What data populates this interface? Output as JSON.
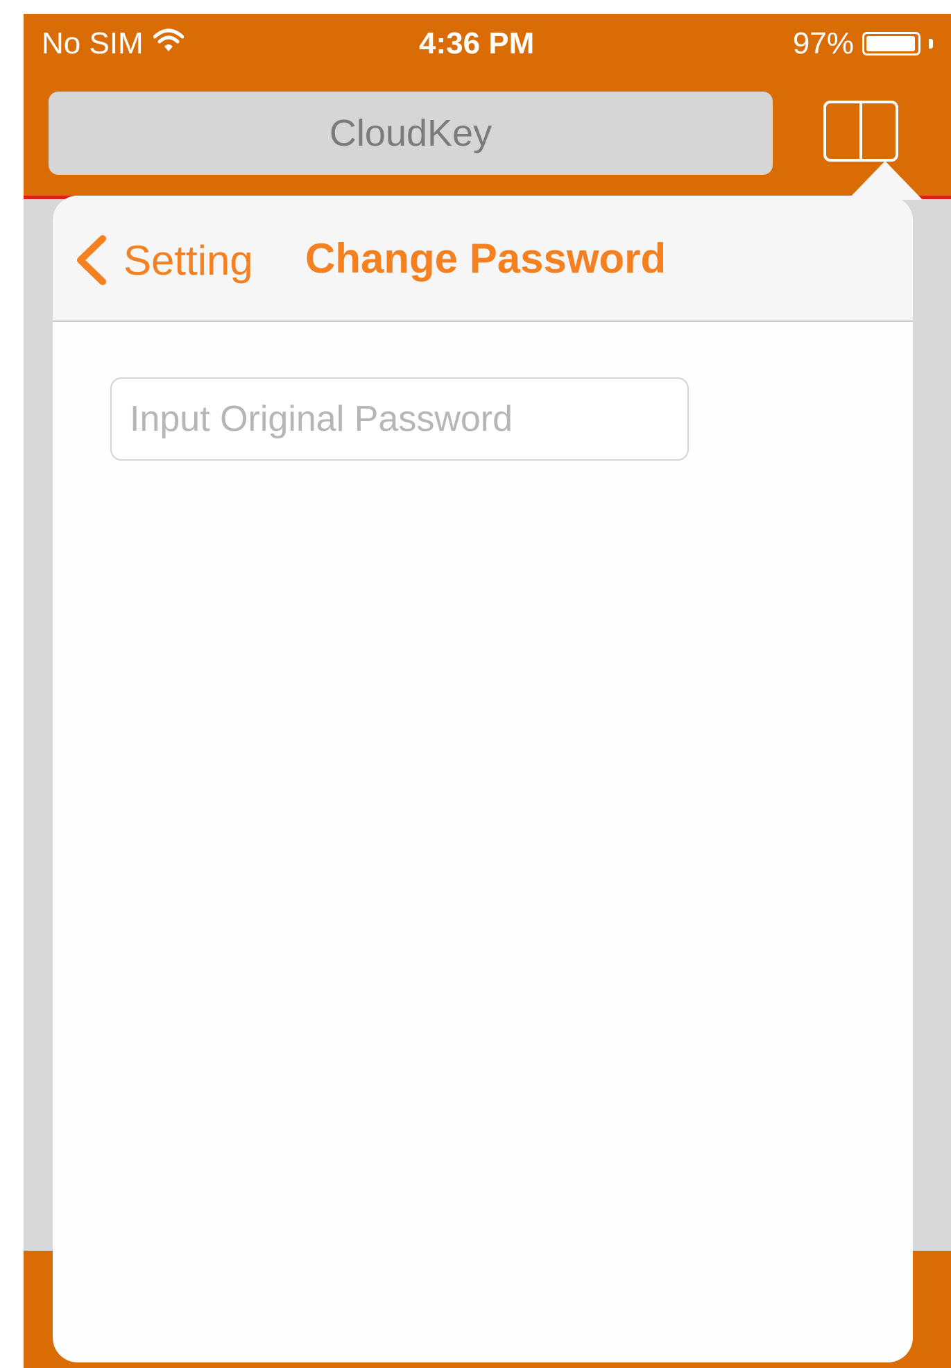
{
  "status_bar": {
    "carrier": "No SIM",
    "time": "4:36 PM",
    "battery_percent": "97%",
    "battery_level": 0.97,
    "wifi_icon": "wifi-icon"
  },
  "browser": {
    "address_text": "CloudKey",
    "bookmark_icon": "book-icon"
  },
  "popover": {
    "back_label": "Setting",
    "title": "Change Password",
    "password_field": {
      "placeholder": "Input Original Password",
      "value": ""
    }
  },
  "colors": {
    "accent": "#d96c05",
    "tint": "#f48020",
    "divider": "#d9201c"
  }
}
